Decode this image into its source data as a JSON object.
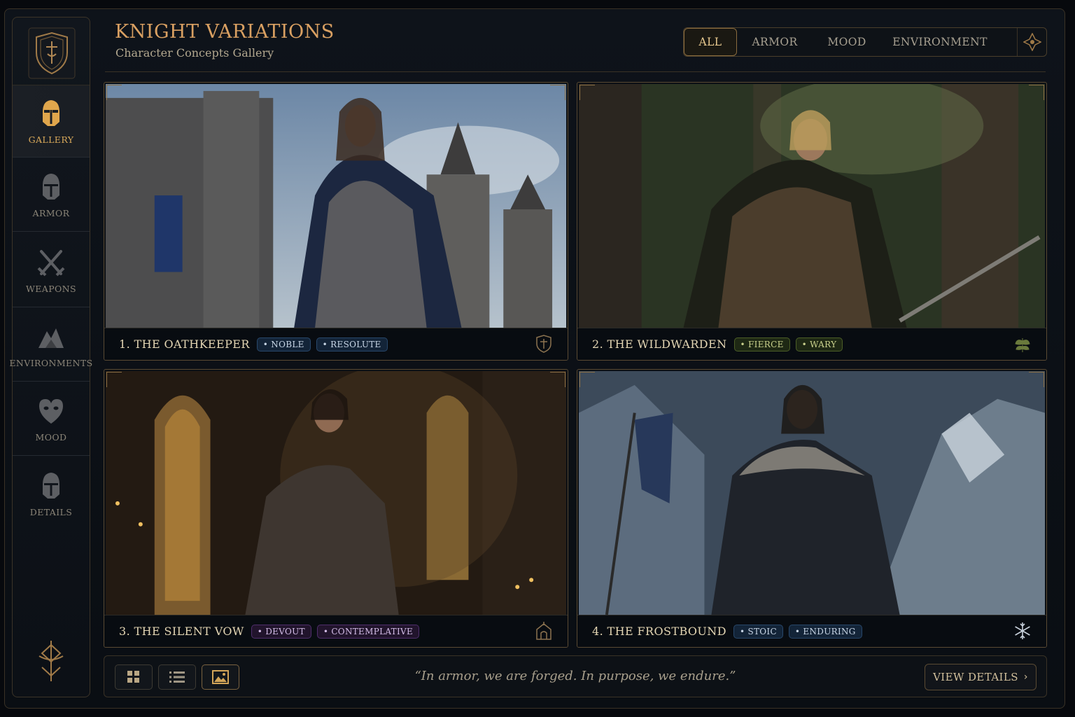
{
  "header": {
    "title": "KNIGHT VARIATIONS",
    "subtitle": "Character Concepts Gallery"
  },
  "filters": [
    {
      "label": "ALL",
      "active": true
    },
    {
      "label": "ARMOR"
    },
    {
      "label": "MOOD"
    },
    {
      "label": "ENVIRONMENT"
    }
  ],
  "sidebar": {
    "items": [
      {
        "label": "GALLERY",
        "icon": "helmet-icon",
        "active": true
      },
      {
        "label": "ARMOR",
        "icon": "armor-helmet-icon"
      },
      {
        "label": "WEAPONS",
        "icon": "crossed-swords-icon"
      },
      {
        "label": "ENVIRONMENTS",
        "icon": "mountains-icon"
      },
      {
        "label": "MOOD",
        "icon": "heart-mask-icon"
      },
      {
        "label": "DETAILS",
        "icon": "helmet-details-icon"
      }
    ]
  },
  "cards": [
    {
      "name": "1. THE OATHKEEPER",
      "tags": [
        "NOBLE",
        "RESOLUTE"
      ],
      "tag_color": "blue",
      "icon": "crest-icon",
      "scene": "castle"
    },
    {
      "name": "2. THE WILDWARDEN",
      "tags": [
        "FIERCE",
        "WARY"
      ],
      "tag_color": "green",
      "icon": "leaf-icon",
      "scene": "forest"
    },
    {
      "name": "3. THE SILENT VOW",
      "tags": [
        "DEVOUT",
        "CONTEMPLATIVE"
      ],
      "tag_color": "purple",
      "icon": "chapel-icon",
      "scene": "cathedral"
    },
    {
      "name": "4. THE FROSTBOUND",
      "tags": [
        "STOIC",
        "ENDURING"
      ],
      "tag_color": "blue",
      "icon": "snowflake-icon",
      "scene": "snow"
    }
  ],
  "footer": {
    "quote": "“In armor, we are forged. In purpose, we endure.”",
    "details_label": "VIEW DETAILS",
    "view_modes": [
      "grid-view-icon",
      "list-view-icon",
      "image-view-icon"
    ]
  },
  "colors": {
    "accent_gold": "#d9a062",
    "tag_blue": "#28476a",
    "tag_green": "#4c5e27",
    "tag_purple": "#4f2e6b"
  }
}
